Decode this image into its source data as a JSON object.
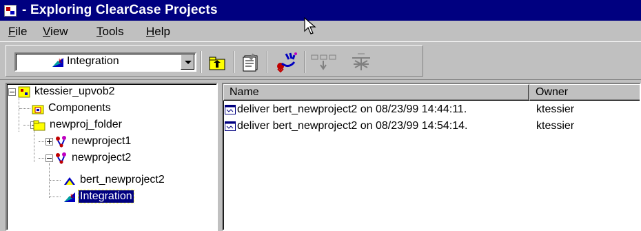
{
  "window": {
    "title": "- Exploring ClearCase Projects"
  },
  "menubar": {
    "items": [
      {
        "label_u": "F",
        "label_rest": "ile"
      },
      {
        "label_u": "V",
        "label_rest": "iew"
      },
      {
        "label_u": "T",
        "label_rest": "ools"
      },
      {
        "label_u": "H",
        "label_rest": "elp"
      }
    ]
  },
  "toolbar": {
    "combo_value": "Integration",
    "buttons": [
      {
        "icon": "up-folder-icon"
      },
      {
        "icon": "properties-icon"
      },
      {
        "icon": "deliver-icon"
      },
      {
        "icon": "rebase-icon"
      },
      {
        "icon": "recommend-baseline-icon"
      }
    ]
  },
  "tree": {
    "nodes": [
      {
        "label": "ktessier_upvob2",
        "icon": "pvob-icon"
      },
      {
        "label": "Components",
        "icon": "components-icon"
      },
      {
        "label": "newproj_folder",
        "icon": "folder-icon"
      },
      {
        "label": "newproject1",
        "icon": "project-icon"
      },
      {
        "label": "newproject2",
        "icon": "project-icon"
      },
      {
        "label": "bert_newproject2",
        "icon": "stream-icon"
      },
      {
        "label": "Integration",
        "icon": "integration-stream-icon"
      }
    ]
  },
  "list": {
    "columns": [
      "Name",
      "Owner"
    ],
    "rows": [
      {
        "name": "deliver bert_newproject2 on 08/23/99 14:44:11.",
        "owner": "ktessier"
      },
      {
        "name": "deliver bert_newproject2 on 08/23/99 14:54:14.",
        "owner": "ktessier"
      }
    ]
  },
  "colors": {
    "titlebar": "#000080",
    "selection": "#000080",
    "face": "#c0c0c0"
  }
}
